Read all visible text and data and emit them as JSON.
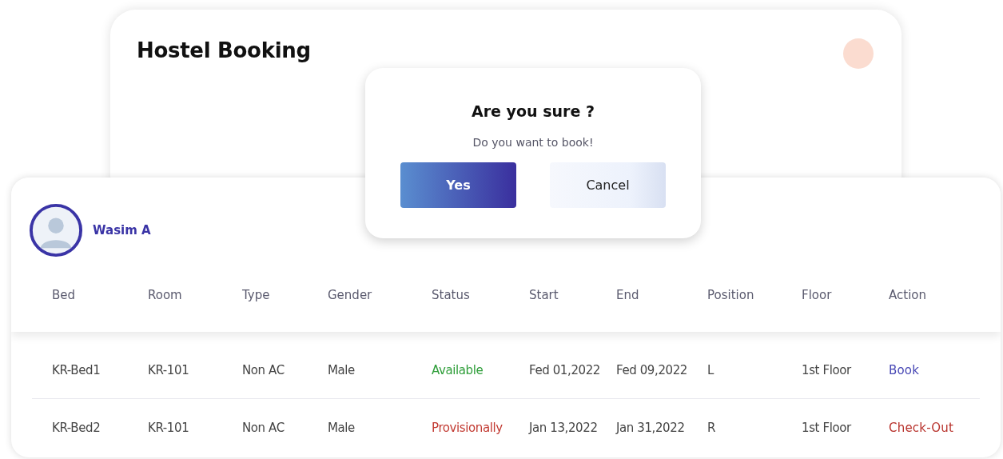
{
  "page": {
    "title": "Hostel Booking"
  },
  "dialog": {
    "title": "Are you sure ?",
    "message": "Do you want to book!",
    "buttons": [
      {
        "label": "Yes",
        "kind": "primary"
      },
      {
        "label": "Cancel",
        "kind": "secondary"
      }
    ]
  },
  "user": {
    "name": "Wasim A"
  },
  "table": {
    "columns": [
      "Bed",
      "Room",
      "Type",
      "Gender",
      "Status",
      "Start",
      "End",
      "Position",
      "Floor",
      "Action"
    ],
    "rows": [
      {
        "cells": [
          {
            "text": "KR-Bed1"
          },
          {
            "text": "KR-101"
          },
          {
            "text": "Non AC"
          },
          {
            "text": "Male"
          },
          {
            "text": "Available",
            "color": "#2f9e3a"
          },
          {
            "text": "Fed 01,2022"
          },
          {
            "text": "Fed 09,2022"
          },
          {
            "text": "L"
          },
          {
            "text": "1st Floor"
          },
          {
            "text": "Book",
            "kind": "link",
            "color": "#4646b4"
          }
        ]
      },
      {
        "cells": [
          {
            "text": "KR-Bed2"
          },
          {
            "text": "KR-101"
          },
          {
            "text": "Non AC"
          },
          {
            "text": "Male"
          },
          {
            "text": "Provisionally",
            "color": "#c23a32"
          },
          {
            "text": "Jan 13,2022"
          },
          {
            "text": "Jan 31,2022"
          },
          {
            "text": "R"
          },
          {
            "text": "1st Floor"
          },
          {
            "text": "Check-Out",
            "kind": "link",
            "color": "#b8322c"
          }
        ]
      }
    ]
  }
}
